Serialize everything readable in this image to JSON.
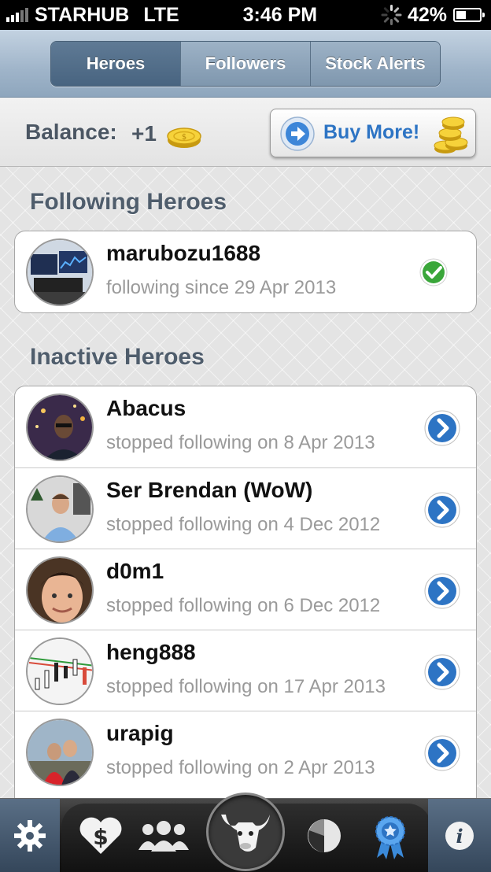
{
  "status_bar": {
    "carrier": "STARHUB",
    "network": "LTE",
    "time": "3:46 PM",
    "battery": "42%",
    "battery_level": 0.42
  },
  "segmented": {
    "tabs": [
      {
        "label": "Heroes",
        "active": true
      },
      {
        "label": "Followers",
        "active": false
      },
      {
        "label": "Stock Alerts",
        "active": false
      }
    ]
  },
  "balance": {
    "label": "Balance:",
    "value": "+1",
    "buy_label": "Buy More!"
  },
  "sections": {
    "following_title": "Following Heroes",
    "inactive_title": "Inactive Heroes"
  },
  "following": [
    {
      "name": "marubozu1688",
      "subtitle": "following since 29 Apr 2013"
    }
  ],
  "inactive": [
    {
      "name": "Abacus",
      "subtitle": "stopped following on 8 Apr 2013"
    },
    {
      "name": "Ser Brendan (WoW)",
      "subtitle": "stopped following on 4 Dec 2012"
    },
    {
      "name": "d0m1",
      "subtitle": "stopped following on 6 Dec 2012"
    },
    {
      "name": "heng888",
      "subtitle": "stopped following on 17 Apr 2013"
    },
    {
      "name": "urapig",
      "subtitle": "stopped following on 2 Apr 2013"
    }
  ],
  "tab_bar": {
    "icons": [
      "gear-icon",
      "heart-dollar-icon",
      "people-icon",
      "bull-icon",
      "pie-chart-icon",
      "award-ribbon-icon",
      "info-icon"
    ],
    "active": "award-ribbon-icon"
  },
  "colors": {
    "accent_blue": "#2d74c4",
    "check_green": "#3aa63a",
    "section_title": "#4f5d6c"
  }
}
